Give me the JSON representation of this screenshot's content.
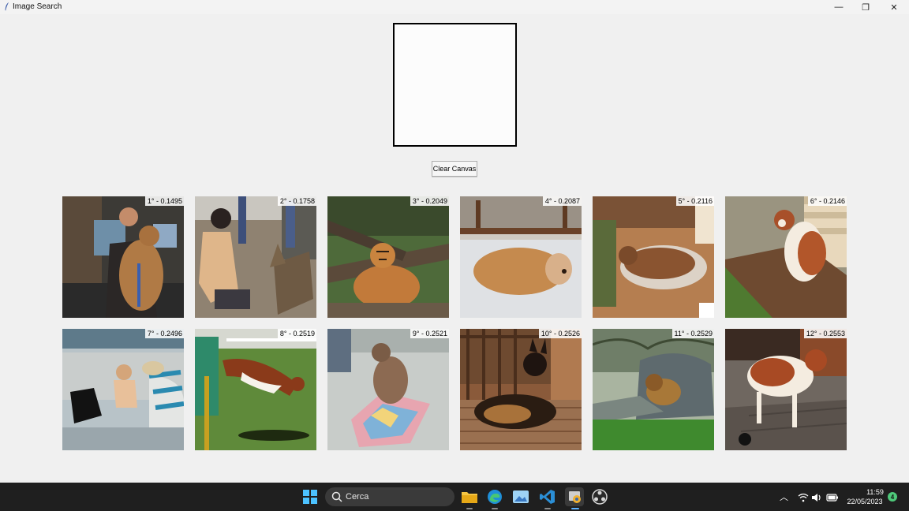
{
  "window": {
    "title": "Image Search",
    "minimize_glyph": "—",
    "maximize_glyph": "❐",
    "close_glyph": "✕"
  },
  "canvas": {
    "clear_label": "Clear Canvas"
  },
  "results": [
    {
      "label": "1° - 0.1495",
      "subject": "man with dog indoors"
    },
    {
      "label": "2° - 0.1758",
      "subject": "woman feeding deer"
    },
    {
      "label": "3° - 0.2049",
      "subject": "tiger on tree"
    },
    {
      "label": "4° - 0.2087",
      "subject": "dog lying on blanket"
    },
    {
      "label": "5° - 0.2116",
      "subject": "dog lying on floor"
    },
    {
      "label": "6° - 0.2146",
      "subject": "st bernard sitting"
    },
    {
      "label": "7° - 0.2496",
      "subject": "dogs at playground"
    },
    {
      "label": "8° - 0.2519",
      "subject": "dog jumping on grass"
    },
    {
      "label": "9° - 0.2521",
      "subject": "dog on cushion"
    },
    {
      "label": "10° - 0.2526",
      "subject": "german shepherd on porch"
    },
    {
      "label": "11° - 0.2529",
      "subject": "lion on rock"
    },
    {
      "label": "12° - 0.2553",
      "subject": "st bernard standing"
    }
  ],
  "taskbar": {
    "search_placeholder": "Cerca",
    "time": "11:59",
    "date": "22/05/2023",
    "notification_count": "4"
  },
  "colors": {
    "taskbar_bg": "#1f1f1f",
    "app_bg": "#f0f0f0",
    "notif_badge": "#4ec97a"
  }
}
